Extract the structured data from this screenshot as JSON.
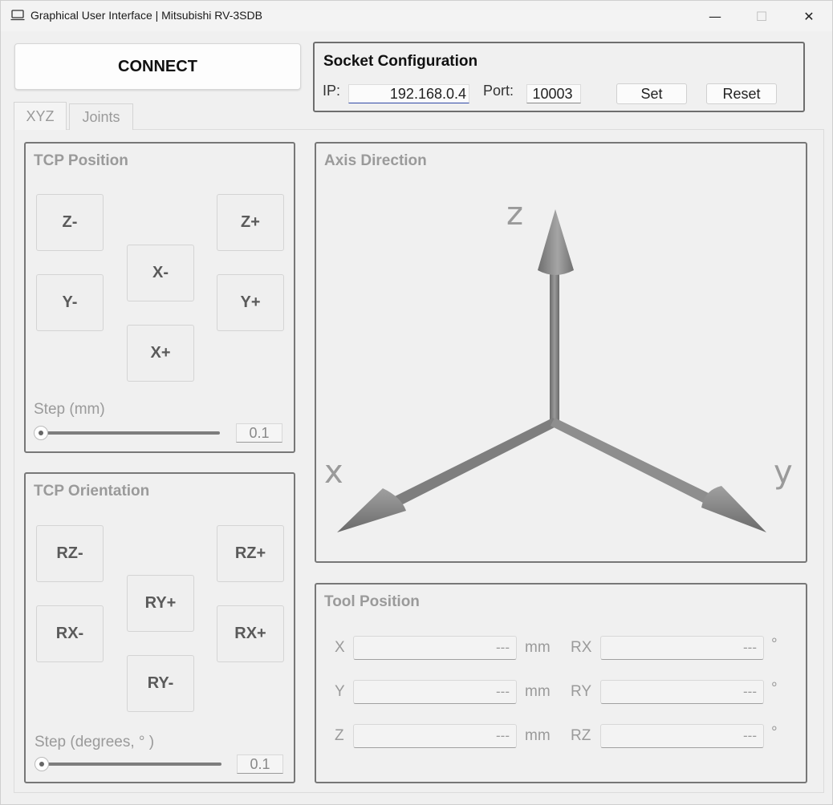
{
  "window": {
    "title": "Graphical User Interface | Mitsubishi RV-3SDB",
    "minimize_glyph": "—",
    "maximize_glyph": "☐",
    "close_glyph": "✕"
  },
  "connect_label": "CONNECT",
  "socket": {
    "title": "Socket Configuration",
    "ip_label": "IP:",
    "ip_value": "192.168.0.4",
    "port_label": "Port:",
    "port_value": "10003",
    "set_label": "Set",
    "reset_label": "Reset"
  },
  "tabs": [
    {
      "label": "XYZ",
      "active": true
    },
    {
      "label": "Joints",
      "active": false
    }
  ],
  "tcp_position": {
    "title": "TCP Position",
    "buttons": {
      "z_minus": "Z-",
      "z_plus": "Z+",
      "x_minus": "X-",
      "y_minus": "Y-",
      "y_plus": "Y+",
      "x_plus": "X+"
    },
    "step_label": "Step (mm)",
    "step_value": "0.1",
    "step_fraction": 0.0
  },
  "tcp_orientation": {
    "title": "TCP Orientation",
    "buttons": {
      "rz_minus": "RZ-",
      "rz_plus": "RZ+",
      "ry_plus": "RY+",
      "rx_minus": "RX-",
      "rx_plus": "RX+",
      "ry_minus": "RY-"
    },
    "step_label": "Step (degrees, ° )",
    "step_value": "0.1",
    "step_fraction": 0.0
  },
  "axis_direction": {
    "title": "Axis Direction",
    "labels": {
      "z": "z",
      "x": "x",
      "y": "y"
    },
    "axis_color": "#7a7a7a",
    "label_color": "#9a9a9a"
  },
  "tool_position": {
    "title": "Tool Position",
    "rows": [
      {
        "label": "X",
        "value": "---",
        "unit": "mm",
        "rot_label": "RX",
        "rot_value": "---",
        "rot_unit": "°"
      },
      {
        "label": "Y",
        "value": "---",
        "unit": "mm",
        "rot_label": "RY",
        "rot_value": "---",
        "rot_unit": "°"
      },
      {
        "label": "Z",
        "value": "---",
        "unit": "mm",
        "rot_label": "RZ",
        "rot_value": "---",
        "rot_unit": "°"
      }
    ]
  }
}
